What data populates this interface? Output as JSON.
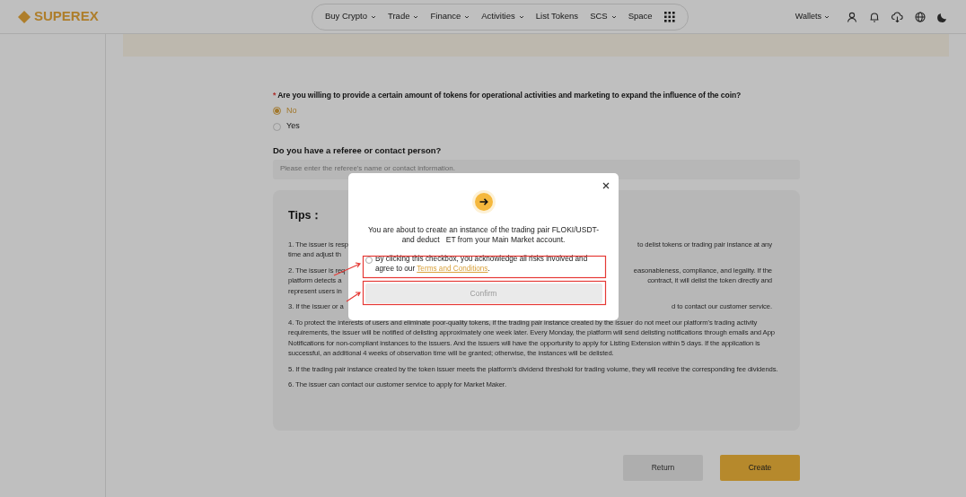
{
  "header": {
    "logo": "SUPEREX",
    "nav": [
      {
        "label": "Buy Crypto",
        "dropdown": true
      },
      {
        "label": "Trade",
        "dropdown": true
      },
      {
        "label": "Finance",
        "dropdown": true
      },
      {
        "label": "Activities",
        "dropdown": true
      },
      {
        "label": "List Tokens",
        "dropdown": false
      },
      {
        "label": "SCS",
        "dropdown": true
      },
      {
        "label": "Space",
        "dropdown": false
      }
    ],
    "wallets": "Wallets"
  },
  "form": {
    "question": {
      "required_mark": "*",
      "text": "Are you willing to provide a certain amount of tokens for operational activities and marketing to expand the influence of the coin?",
      "options": [
        {
          "label": "No",
          "selected": true
        },
        {
          "label": "Yes",
          "selected": false
        }
      ]
    },
    "referee": {
      "label": "Do you have a referee or contact person?",
      "placeholder": "Please enter the referee's name or contact information."
    }
  },
  "tips": {
    "title": "Tips：",
    "items": [
      {
        "lines": [
          {
            "left": "1. The issuer is resp",
            "right": "to delist tokens or trading pair instance at any"
          },
          {
            "left": "time and adjust th"
          }
        ]
      },
      {
        "lines": [
          {
            "left": "2. The issuer is req",
            "right": "easonableness, compliance, and legality. If the"
          },
          {
            "left": "platform detects a",
            "right": "contract, it will delist the token directly and"
          },
          {
            "left": "represent users in"
          }
        ]
      },
      {
        "lines": [
          {
            "left": "3. If the issuer or a",
            "right": "d to contact our customer service."
          }
        ]
      },
      {
        "text": "4. To protect the interests of users and eliminate poor-quality tokens, if the trading pair instance created by the issuer do not meet our platform's trading activity requirements, the issuer will be notified of delisting approximately one week later. Every Monday, the platform will send delisting notifications through emails and App Notifications for non-compliant instances to the issuers. And the issuers will have the opportunity to apply for Listing Extension within 5 days. If the application is successful, an additional 4 weeks of observation time will be granted; otherwise, the instances will be delisted."
      },
      {
        "text": "5. If the trading pair instance created by the token issuer meets the platform's dividend threshold for trading volume, they will receive the corresponding fee dividends."
      },
      {
        "text": "6. The issuer can contact our customer service to apply for Market Maker."
      }
    ]
  },
  "buttons": [
    {
      "label": "Return",
      "kind": "secondary"
    },
    {
      "label": "Create",
      "kind": "primary"
    }
  ],
  "dialog": {
    "message_lines": [
      "You are about to create an instance of the trading pair FLOKI/USDT-",
      "and deduct   ET from your Main Market account."
    ],
    "checkbox": {
      "checked": false,
      "text": "By clicking this checkbox, you acknowledge all risks involved and agree to our ",
      "link": "Terms and Conditions",
      "text_after": "."
    },
    "confirm": {
      "label": "Confirm",
      "disabled": true
    }
  }
}
